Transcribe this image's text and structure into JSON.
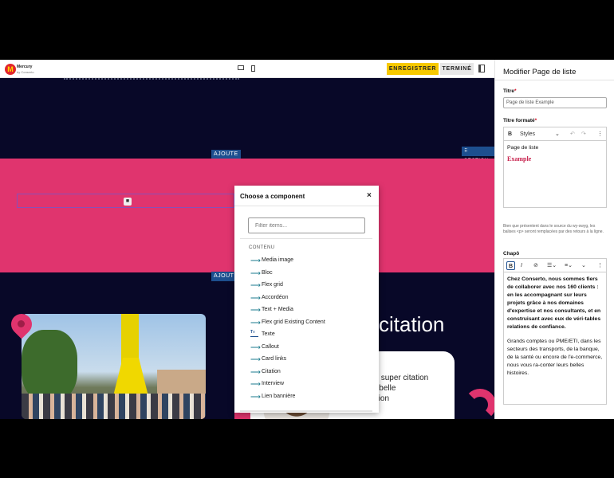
{
  "toolbar": {
    "logo_mark": "M",
    "logo_name": "Mercury",
    "logo_sub": "by Conserto",
    "save_label": "ENREGISTRER",
    "done_label": "TERMINÉ"
  },
  "canvas": {
    "add_tag_1": "AJOUTE",
    "add_tag_2": "AJOUTE",
    "section_tag": "⠿ SECTION",
    "citation_heading": "citation",
    "quote_text": "C'est une super citation pour une belle présentation"
  },
  "modal": {
    "title": "Choose a component",
    "close": "×",
    "filter_placeholder": "Filter items...",
    "category": "CONTENU",
    "items": [
      {
        "label": "Media image",
        "icon": "arrow-right-icon"
      },
      {
        "label": "Bloc",
        "icon": "arrow-right-icon"
      },
      {
        "label": "Flex grid",
        "icon": "arrow-right-icon"
      },
      {
        "label": "Accordéon",
        "icon": "arrow-right-icon"
      },
      {
        "label": "Text + Media",
        "icon": "arrow-right-icon"
      },
      {
        "label": "Flex grid Existing Content",
        "icon": "arrow-right-icon"
      },
      {
        "label": "Texte",
        "icon": "text-block-icon"
      },
      {
        "label": "Callout",
        "icon": "arrow-right-icon"
      },
      {
        "label": "Card links",
        "icon": "arrow-right-icon"
      },
      {
        "label": "Citation",
        "icon": "arrow-right-icon"
      },
      {
        "label": "Interview",
        "icon": "arrow-right-icon"
      },
      {
        "label": "Lien bannière",
        "icon": "arrow-right-icon"
      }
    ]
  },
  "side": {
    "title": "Modifier Page de liste",
    "titre_label": "Titre",
    "titre_value": "Page de liste Example",
    "titre_formate_label": "Titre formaté",
    "styles_label": "Styles",
    "wys1_line1": "Page de liste",
    "wys1_line2": "Example",
    "help_text": "Bien que présentent dans le source du wy-swyg, les balises <p> seront remplacées par des retours à la ligne.",
    "chapo_label": "Chapô",
    "chapo_bold": "Chez Conserto, nous sommes fiers de collaborer avec nos 160 clients : en les accompagnant sur leurs projets grâce à nos domaines d'expertise et nos consultants, et en construisant avec eux de véri-tables relations de confiance.",
    "chapo_normal": "Grands comptes ou PME/ETI, dans les secteurs des transports, de la banque, de la santé ou encore de l'e-commerce, nous vous ra-conter leurs belles histoires."
  },
  "colors": {
    "accent_yellow": "#f7c900",
    "brand_pink": "#e0346e",
    "canvas_navy": "#080828",
    "tag_blue": "#1d4f8f"
  }
}
